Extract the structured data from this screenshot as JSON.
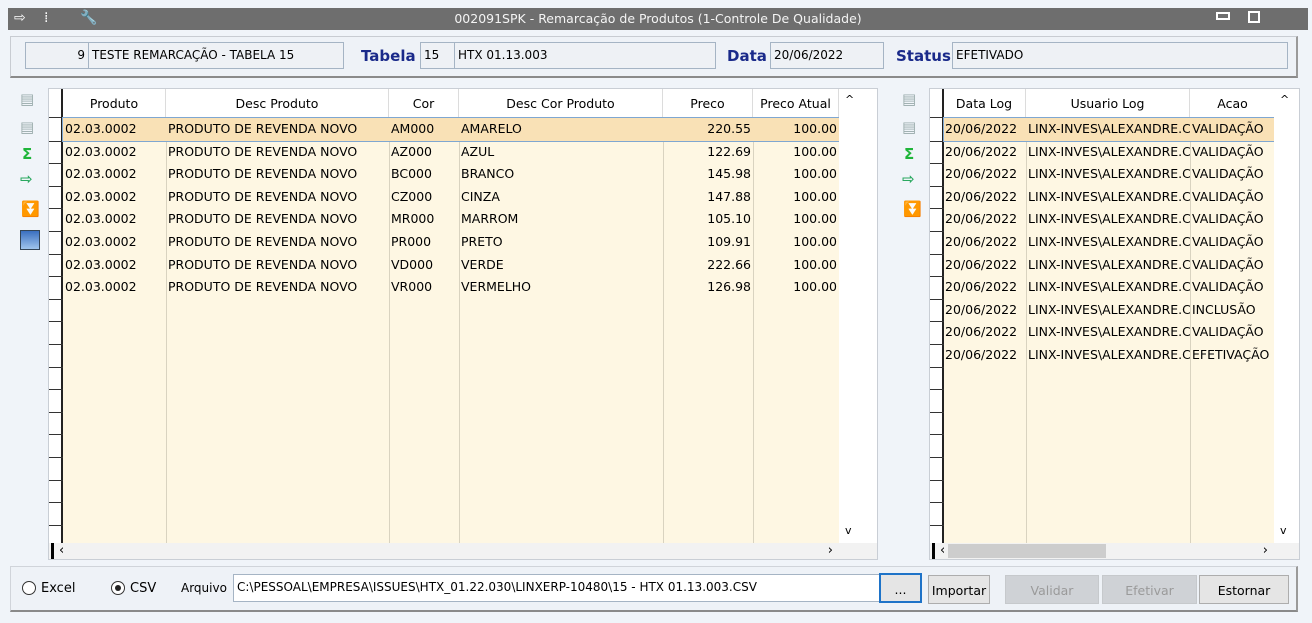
{
  "window": {
    "title": "002091SPK - Remarcação de Produtos (1-Controle De Qualidade)",
    "icons": [
      "exit-icon",
      "traffic-light-icon",
      "wrench-icon"
    ]
  },
  "header": {
    "code": "9",
    "desc": "TESTE REMARCAÇÃO - TABELA 15",
    "tabela_label": "Tabela",
    "tabela_code": "15",
    "tabela_desc": "HTX 01.13.003",
    "data_label": "Data",
    "data_value": "20/06/2022",
    "status_label": "Status",
    "status_value": "EFETIVADO"
  },
  "products": {
    "columns": [
      "Produto",
      "Desc Produto",
      "Cor",
      "Desc Cor Produto",
      "Preco",
      "Preco Atual"
    ],
    "rows": [
      [
        "02.03.0002",
        "PRODUTO DE REVENDA NOVO",
        "AM000",
        "AMARELO",
        "220.55",
        "100.00"
      ],
      [
        "02.03.0002",
        "PRODUTO DE REVENDA NOVO",
        "AZ000",
        "AZUL",
        "122.69",
        "100.00"
      ],
      [
        "02.03.0002",
        "PRODUTO DE REVENDA NOVO",
        "BC000",
        "BRANCO",
        "145.98",
        "100.00"
      ],
      [
        "02.03.0002",
        "PRODUTO DE REVENDA NOVO",
        "CZ000",
        "CINZA",
        "147.88",
        "100.00"
      ],
      [
        "02.03.0002",
        "PRODUTO DE REVENDA NOVO",
        "MR000",
        "MARROM",
        "105.10",
        "100.00"
      ],
      [
        "02.03.0002",
        "PRODUTO DE REVENDA NOVO",
        "PR000",
        "PRETO",
        "109.91",
        "100.00"
      ],
      [
        "02.03.0002",
        "PRODUTO DE REVENDA NOVO",
        "VD000",
        "VERDE",
        "222.66",
        "100.00"
      ],
      [
        "02.03.0002",
        "PRODUTO DE REVENDA NOVO",
        "VR000",
        "VERMELHO",
        "126.98",
        "100.00"
      ]
    ]
  },
  "log": {
    "columns": [
      "Data Log",
      "Usuario Log",
      "Acao"
    ],
    "rows": [
      [
        "20/06/2022",
        "LINX-INVES\\ALEXANDRE.C",
        "VALIDAÇÃO"
      ],
      [
        "20/06/2022",
        "LINX-INVES\\ALEXANDRE.C",
        "VALIDAÇÃO"
      ],
      [
        "20/06/2022",
        "LINX-INVES\\ALEXANDRE.C",
        "VALIDAÇÃO"
      ],
      [
        "20/06/2022",
        "LINX-INVES\\ALEXANDRE.C",
        "VALIDAÇÃO"
      ],
      [
        "20/06/2022",
        "LINX-INVES\\ALEXANDRE.C",
        "VALIDAÇÃO"
      ],
      [
        "20/06/2022",
        "LINX-INVES\\ALEXANDRE.C",
        "VALIDAÇÃO"
      ],
      [
        "20/06/2022",
        "LINX-INVES\\ALEXANDRE.C",
        "VALIDAÇÃO"
      ],
      [
        "20/06/2022",
        "LINX-INVES\\ALEXANDRE.C",
        "VALIDAÇÃO"
      ],
      [
        "20/06/2022",
        "LINX-INVES\\ALEXANDRE.C",
        "INCLUSÃO"
      ],
      [
        "20/06/2022",
        "LINX-INVES\\ALEXANDRE.C",
        "VALIDAÇÃO"
      ],
      [
        "20/06/2022",
        "LINX-INVES\\ALEXANDRE.C",
        "EFETIVAÇÃO"
      ]
    ]
  },
  "bottom": {
    "excel": "Excel",
    "csv": "CSV",
    "selected": "CSV",
    "arquivo_label": "Arquivo",
    "arquivo_value": "C:\\PESSOAL\\EMPRESA\\ISSUES\\HTX_01.22.030\\LINXERP-10480\\15 - HTX 01.13.003.CSV",
    "browse": "...",
    "importar": "Importar",
    "validar": "Validar",
    "efetivar": "Efetivar",
    "estornar": "Estornar"
  }
}
